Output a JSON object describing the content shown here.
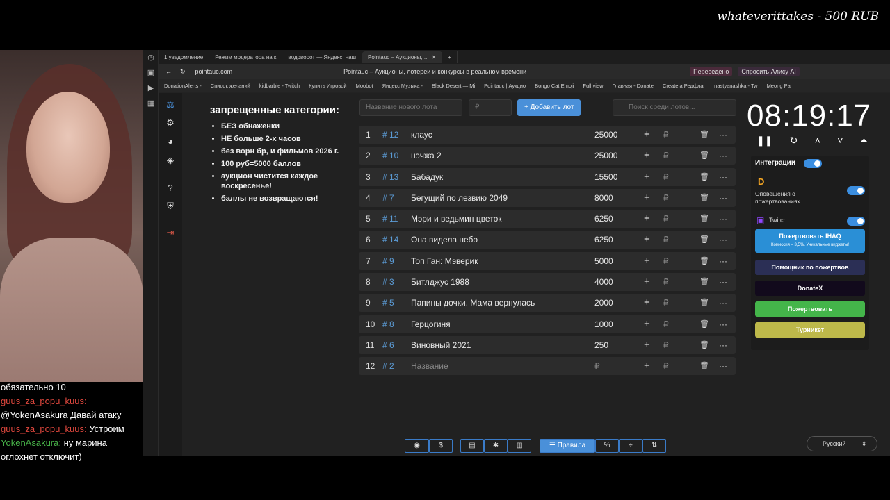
{
  "overlay": {
    "donation": "whateverittakes - 500 RUB"
  },
  "chat": [
    {
      "user": "",
      "text": "обязательно 10"
    },
    {
      "user": "guus_za_popu_kuus:",
      "text": ""
    },
    {
      "user": "",
      "text": "@YokenAsakura Давай атаку"
    },
    {
      "user": "guus_za_popu_kuus:",
      "text": "Устроим"
    },
    {
      "user": "YokenAsakura:",
      "text": "ну марина"
    },
    {
      "user": "",
      "text": "оглохнет отключит)"
    }
  ],
  "browser": {
    "tabs": [
      "1 уведомление",
      "Режим модератора на к",
      "водоворот — Яндекс: наш",
      "Pointauc – Аукционы, ..."
    ],
    "url": "pointauc.com",
    "page_title": "Pointauc – Аукционы, лотереи и конкурсы в реальном времени",
    "translated": "Переведено",
    "alice": "Спросить Алису AI",
    "bookmarks": [
      "DonationAlerts -",
      "Список желаний",
      "kidbarbie - Twitch",
      "Купить Игровой",
      "Moobot",
      "Яндекс Музыка -",
      "Black Desert — Mi",
      "Pointauc | Аукцио",
      "Bongo Cat Emoji",
      "Full view",
      "Главная - Donate",
      "Create a Редфлаг",
      "nastyanashka - Tw",
      "Meong Pa"
    ]
  },
  "rules": {
    "title": "запрещенные категории:",
    "items": [
      "БЕЗ обнаженки",
      "НЕ больше 2-х часов",
      "без ворн бр, и фильмов 2026 г.",
      "100 руб=5000 баллов",
      "аукцион чистится каждое воскресенье!",
      "баллы не возвращаются!"
    ]
  },
  "controls": {
    "new_lot_ph": "Название нового лота",
    "amount_ph": "₽",
    "add_label": "Добавить лот",
    "search_ph": "Поиск среди лотов..."
  },
  "lots": [
    {
      "n": "1",
      "id": "# 12",
      "name": "клаус",
      "amount": "25000"
    },
    {
      "n": "2",
      "id": "# 10",
      "name": "нэчжа 2",
      "amount": "25000"
    },
    {
      "n": "3",
      "id": "# 13",
      "name": "Бабадук",
      "amount": "15500"
    },
    {
      "n": "4",
      "id": "# 7",
      "name": "Бегущий по лезвию 2049",
      "amount": "8000"
    },
    {
      "n": "5",
      "id": "# 11",
      "name": "Мэри и ведьмин цветок",
      "amount": "6250"
    },
    {
      "n": "6",
      "id": "# 14",
      "name": "Она видела небо",
      "amount": "6250"
    },
    {
      "n": "7",
      "id": "# 9",
      "name": "Топ Ган: Мэверик",
      "amount": "5000"
    },
    {
      "n": "8",
      "id": "# 3",
      "name": "Битлджус 1988",
      "amount": "4000"
    },
    {
      "n": "9",
      "id": "# 5",
      "name": "Папины дочки. Мама вернулась",
      "amount": "2000"
    },
    {
      "n": "10",
      "id": "# 8",
      "name": "Герцогиня",
      "amount": "1000"
    },
    {
      "n": "11",
      "id": "# 6",
      "name": "Виновный 2021",
      "amount": "250"
    },
    {
      "n": "12",
      "id": "# 2",
      "name": "Название",
      "amount": "₽"
    }
  ],
  "timer": "08:19:17",
  "integrations": {
    "title": "Интеграции",
    "alerts": "Оповещения о пожертвованиях",
    "twitch": "Twitch",
    "donate_ihaq": "Пожертвовать IHAQ",
    "donate_ihaq_sub": "Комиссия – 3,5%. Уникальные виджеты!",
    "helper": "Помощник по пожертвов",
    "donatex": "DonateX",
    "donate": "Пожертвовать",
    "turniket": "Турникет"
  },
  "bottom": {
    "rules_label": "Правила",
    "lang": "Русский"
  }
}
